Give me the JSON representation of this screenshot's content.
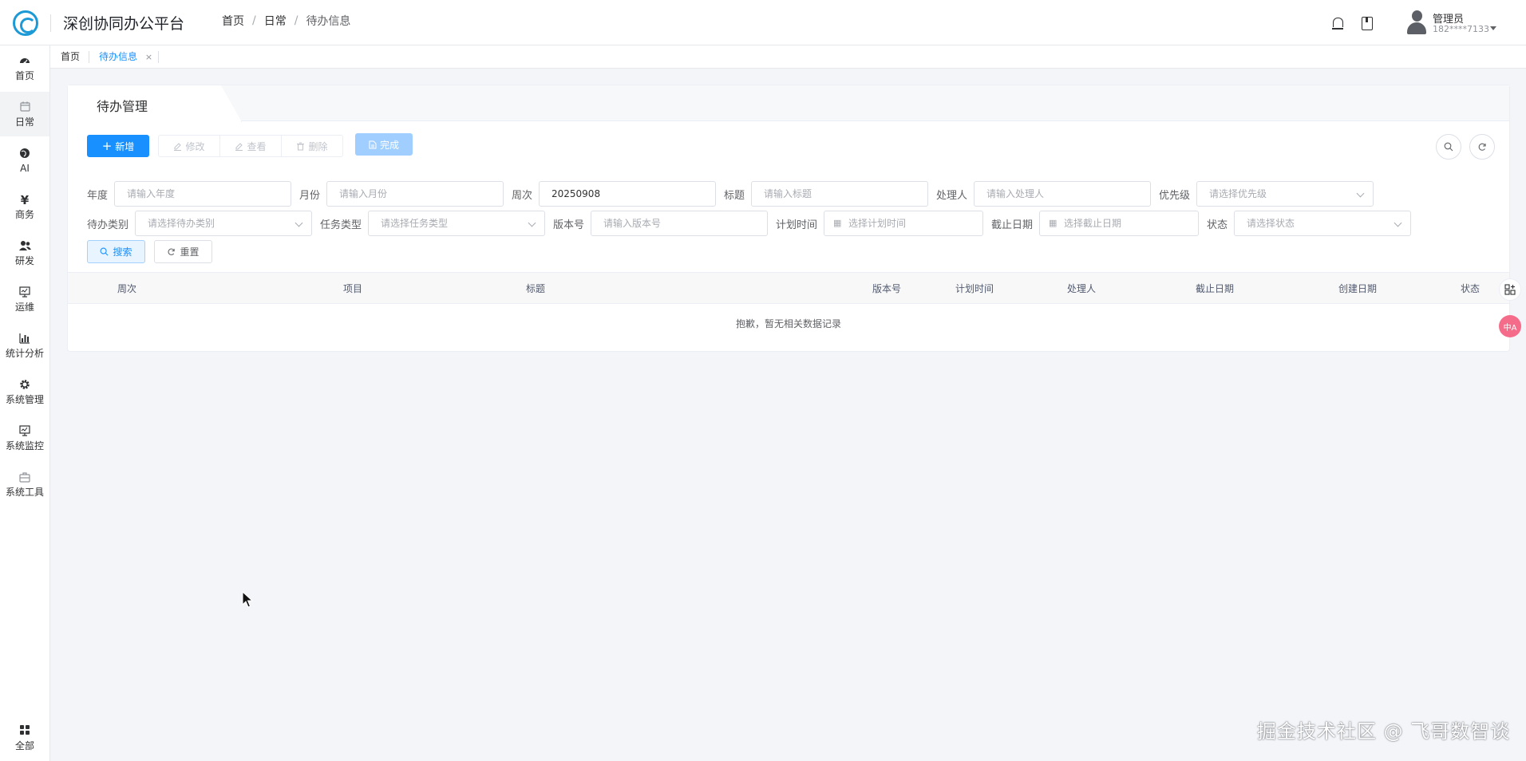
{
  "header": {
    "title": "深创协同办公平台",
    "breadcrumb": [
      "首页",
      "日常",
      "待办信息"
    ],
    "user": {
      "name": "管理员",
      "phone": "182****7133"
    }
  },
  "sidebar": {
    "items": [
      {
        "label": "首页",
        "icon": "dashboard-icon"
      },
      {
        "label": "日常",
        "icon": "calendar-icon",
        "active": true
      },
      {
        "label": "AI",
        "icon": "globe-icon"
      },
      {
        "label": "商务",
        "icon": "yen-icon"
      },
      {
        "label": "研发",
        "icon": "people-icon"
      },
      {
        "label": "运维",
        "icon": "monitor-icon"
      },
      {
        "label": "统计分析",
        "icon": "bar-chart-icon"
      },
      {
        "label": "系统管理",
        "icon": "gear-icon"
      },
      {
        "label": "系统监控",
        "icon": "monitor-icon"
      },
      {
        "label": "系统工具",
        "icon": "toolbox-icon"
      }
    ],
    "bottom": {
      "label": "全部",
      "icon": "grid-icon"
    }
  },
  "tags": {
    "home": "首页",
    "current": "待办信息",
    "close": "×"
  },
  "card": {
    "tab_title": "待办管理"
  },
  "toolbar": {
    "add": "新增",
    "edit": "修改",
    "view": "查看",
    "delete": "删除",
    "complete": "完成"
  },
  "filters": {
    "year": {
      "label": "年度",
      "placeholder": "请输入年度"
    },
    "month": {
      "label": "月份",
      "placeholder": "请输入月份"
    },
    "week": {
      "label": "周次",
      "value": "20250908"
    },
    "title": {
      "label": "标题",
      "placeholder": "请输入标题"
    },
    "handler": {
      "label": "处理人",
      "placeholder": "请输入处理人"
    },
    "priority": {
      "label": "优先级",
      "placeholder": "请选择优先级"
    },
    "todo_type": {
      "label": "待办类别",
      "placeholder": "请选择待办类别"
    },
    "task_type": {
      "label": "任务类型",
      "placeholder": "请选择任务类型"
    },
    "version": {
      "label": "版本号",
      "placeholder": "请输入版本号"
    },
    "plan_time": {
      "label": "计划时间",
      "placeholder": "选择计划时间"
    },
    "deadline": {
      "label": "截止日期",
      "placeholder": "选择截止日期"
    },
    "status": {
      "label": "状态",
      "placeholder": "请选择状态"
    },
    "search_button": "搜索",
    "reset_button": "重置"
  },
  "table": {
    "columns": [
      "周次",
      "项目",
      "标题",
      "版本号",
      "计划时间",
      "处理人",
      "截止日期",
      "创建日期",
      "状态"
    ],
    "empty_text": "抱歉，暂无相关数据记录"
  },
  "floating": {
    "translate_label": "中A"
  },
  "watermark": "掘金技术社区 @ 飞哥数智谈",
  "colors": {
    "primary": "#1890ff",
    "primary_light": "#a0cfff",
    "brand": "#1d9ad6"
  }
}
